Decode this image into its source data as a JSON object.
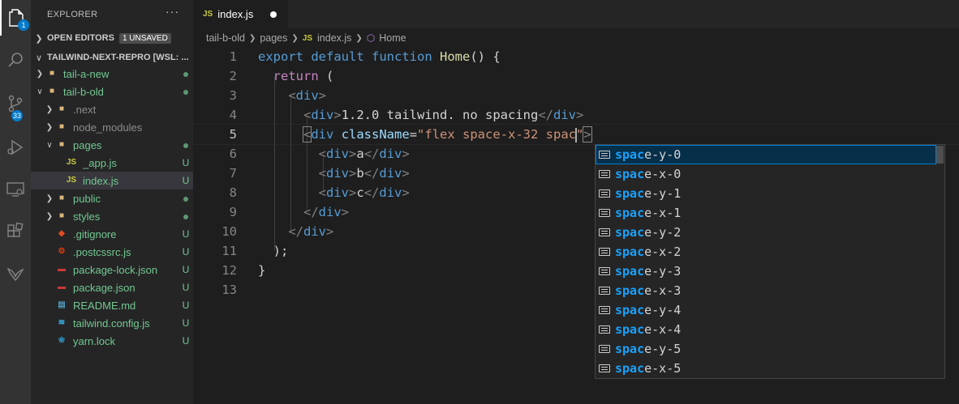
{
  "activity_bar": {
    "explorer_badge": "1",
    "source_control_badge": "33",
    "items": [
      "files-icon",
      "search-icon",
      "source-control-icon",
      "run-debug-icon",
      "remote-explorer-icon",
      "extensions-icon",
      "bird-icon"
    ]
  },
  "sidebar": {
    "title": "EXPLORER",
    "more": "···",
    "open_editors": {
      "label": "OPEN EDITORS",
      "badge": "1 UNSAVED"
    },
    "workspace": {
      "label": "TAILWIND-NEXT-REPRO [WSL: ..."
    },
    "tree": [
      {
        "label": "tail-a-new",
        "type": "folder",
        "expanded": false,
        "status": "dot"
      },
      {
        "label": "tail-b-old",
        "type": "folder",
        "expanded": true,
        "status": "dot"
      },
      {
        "label": ".next",
        "type": "folder",
        "expanded": false,
        "status": ""
      },
      {
        "label": "node_modules",
        "type": "folder",
        "expanded": false,
        "status": ""
      },
      {
        "label": "pages",
        "type": "folder",
        "expanded": true,
        "status": "dot"
      },
      {
        "label": "_app.js",
        "type": "js",
        "status": "U"
      },
      {
        "label": "index.js",
        "type": "js",
        "status": "U"
      },
      {
        "label": "public",
        "type": "folder",
        "expanded": false,
        "status": "dot"
      },
      {
        "label": "styles",
        "type": "folder",
        "expanded": false,
        "status": "dot"
      },
      {
        "label": ".gitignore",
        "type": "git",
        "status": "U"
      },
      {
        "label": ".postcssrc.js",
        "type": "gear",
        "status": "U"
      },
      {
        "label": "package-lock.json",
        "type": "npm",
        "status": "U"
      },
      {
        "label": "package.json",
        "type": "npm",
        "status": "U"
      },
      {
        "label": "README.md",
        "type": "md",
        "status": "U"
      },
      {
        "label": "tailwind.config.js",
        "type": "tailwind",
        "status": "U"
      },
      {
        "label": "yarn.lock",
        "type": "yarn",
        "status": "U"
      }
    ]
  },
  "tab": {
    "badge": "JS",
    "label": "index.js"
  },
  "breadcrumb": {
    "folder1": "tail-b-old",
    "folder2": "pages",
    "file": "index.js",
    "symbol": "Home"
  },
  "editor": {
    "line_numbers": [
      "1",
      "2",
      "3",
      "4",
      "5",
      "6",
      "7",
      "8",
      "9",
      "10",
      "11",
      "12",
      "13"
    ],
    "current_line": 5
  },
  "suggestions": {
    "match": "spac",
    "items": [
      {
        "prefix": "spac",
        "rest": "e-y-0"
      },
      {
        "prefix": "spac",
        "rest": "e-x-0"
      },
      {
        "prefix": "spac",
        "rest": "e-y-1"
      },
      {
        "prefix": "spac",
        "rest": "e-x-1"
      },
      {
        "prefix": "spac",
        "rest": "e-y-2"
      },
      {
        "prefix": "spac",
        "rest": "e-x-2"
      },
      {
        "prefix": "spac",
        "rest": "e-y-3"
      },
      {
        "prefix": "spac",
        "rest": "e-x-3"
      },
      {
        "prefix": "spac",
        "rest": "e-y-4"
      },
      {
        "prefix": "spac",
        "rest": "e-x-4"
      },
      {
        "prefix": "spac",
        "rest": "e-y-5"
      },
      {
        "prefix": "spac",
        "rest": "e-x-5"
      }
    ]
  },
  "colors": {
    "activity_bg": "#333333",
    "sidebar_bg": "#252526",
    "editor_bg": "#1e1e1e",
    "accent": "#007acc",
    "git_untracked": "#73c991"
  }
}
